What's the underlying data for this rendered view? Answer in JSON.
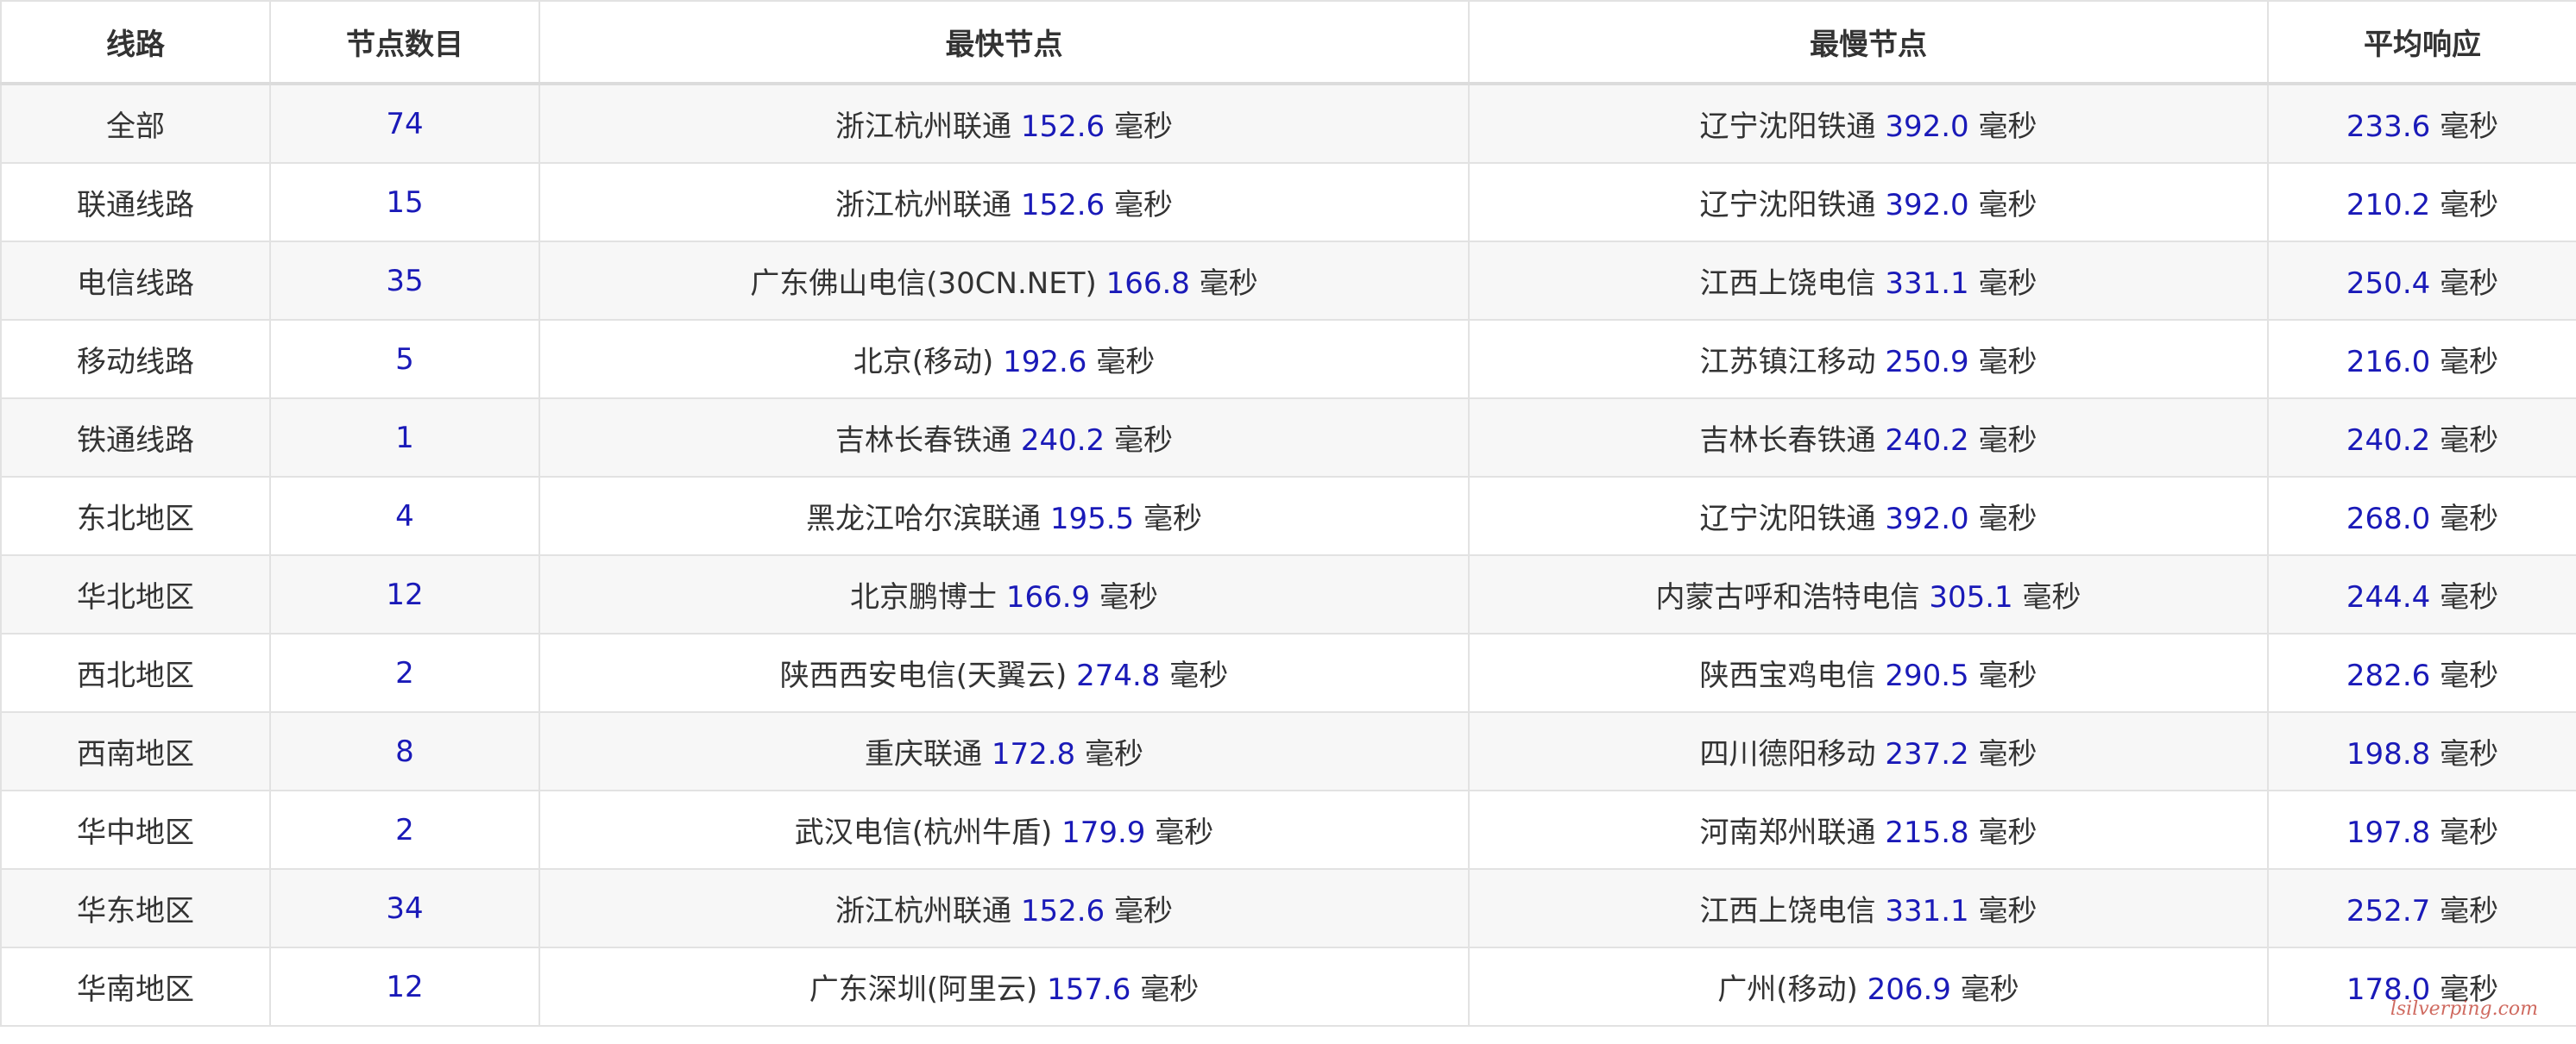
{
  "table": {
    "headers": [
      "线路",
      "节点数目",
      "最快节点",
      "最慢节点",
      "平均响应"
    ],
    "unit": "毫秒",
    "rows": [
      {
        "line": "全部",
        "count": "74",
        "fast_name": "浙江杭州联通",
        "fast_ms": "152.6",
        "slow_name": "辽宁沈阳铁通",
        "slow_ms": "392.0",
        "avg_ms": "233.6",
        "unit": "毫秒"
      },
      {
        "line": "联通线路",
        "count": "15",
        "fast_name": "浙江杭州联通",
        "fast_ms": "152.6",
        "slow_name": "辽宁沈阳铁通",
        "slow_ms": "392.0",
        "avg_ms": "210.2",
        "unit": "毫秒"
      },
      {
        "line": "电信线路",
        "count": "35",
        "fast_name": "广东佛山电信(30CN.NET)",
        "fast_ms": "166.8",
        "slow_name": "江西上饶电信",
        "slow_ms": "331.1",
        "avg_ms": "250.4",
        "unit": "毫秒"
      },
      {
        "line": "移动线路",
        "count": "5",
        "fast_name": "北京(移动)",
        "fast_ms": "192.6",
        "slow_name": "江苏镇江移动",
        "slow_ms": "250.9",
        "avg_ms": "216.0",
        "unit": "毫秒"
      },
      {
        "line": "铁通线路",
        "count": "1",
        "fast_name": "吉林长春铁通",
        "fast_ms": "240.2",
        "slow_name": "吉林长春铁通",
        "slow_ms": "240.2",
        "avg_ms": "240.2",
        "unit": "毫秒"
      },
      {
        "line": "东北地区",
        "count": "4",
        "fast_name": "黑龙江哈尔滨联通",
        "fast_ms": "195.5",
        "slow_name": "辽宁沈阳铁通",
        "slow_ms": "392.0",
        "avg_ms": "268.0",
        "unit": "毫秒"
      },
      {
        "line": "华北地区",
        "count": "12",
        "fast_name": "北京鹏博士",
        "fast_ms": "166.9",
        "slow_name": "内蒙古呼和浩特电信",
        "slow_ms": "305.1",
        "avg_ms": "244.4",
        "unit": "毫秒"
      },
      {
        "line": "西北地区",
        "count": "2",
        "fast_name": "陕西西安电信(天翼云)",
        "fast_ms": "274.8",
        "slow_name": "陕西宝鸡电信",
        "slow_ms": "290.5",
        "avg_ms": "282.6",
        "unit": "毫秒"
      },
      {
        "line": "西南地区",
        "count": "8",
        "fast_name": "重庆联通",
        "fast_ms": "172.8",
        "slow_name": "四川德阳移动",
        "slow_ms": "237.2",
        "avg_ms": "198.8",
        "unit": "毫秒"
      },
      {
        "line": "华中地区",
        "count": "2",
        "fast_name": "武汉电信(杭州牛盾)",
        "fast_ms": "179.9",
        "slow_name": "河南郑州联通",
        "slow_ms": "215.8",
        "avg_ms": "197.8",
        "unit": "毫秒"
      },
      {
        "line": "华东地区",
        "count": "34",
        "fast_name": "浙江杭州联通",
        "fast_ms": "152.6",
        "slow_name": "江西上饶电信",
        "slow_ms": "331.1",
        "avg_ms": "252.7",
        "unit": "毫秒"
      },
      {
        "line": "华南地区",
        "count": "12",
        "fast_name": "广东深圳(阿里云)",
        "fast_ms": "157.6",
        "slow_name": "广州(移动)",
        "slow_ms": "206.9",
        "avg_ms": "178.0",
        "unit": "毫秒"
      }
    ]
  },
  "watermark": "lsilverping.com",
  "colors": {
    "value_blue": "#1a1ab8",
    "text": "#333333",
    "row_alt": "#f7f7f7",
    "border": "#e2e2e2"
  }
}
